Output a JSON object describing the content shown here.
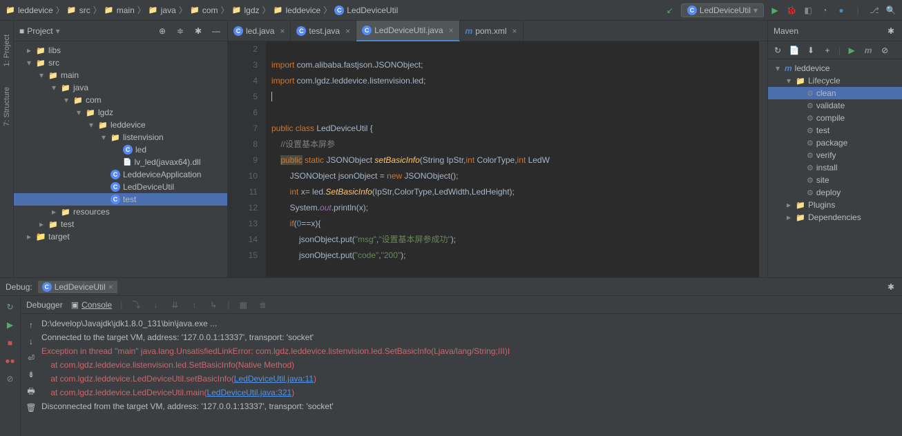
{
  "breadcrumb": [
    "leddevice",
    "src",
    "main",
    "java",
    "com",
    "lgdz",
    "leddevice",
    "LedDeviceUtil"
  ],
  "runConfig": "LedDeviceUtil",
  "projectPanel": {
    "title": "Project",
    "tree": [
      {
        "depth": 0,
        "arrow": "right",
        "icon": "folder",
        "label": "libs"
      },
      {
        "depth": 0,
        "arrow": "down",
        "icon": "folder",
        "label": "src"
      },
      {
        "depth": 1,
        "arrow": "down",
        "icon": "folder",
        "label": "main"
      },
      {
        "depth": 2,
        "arrow": "down",
        "icon": "folder",
        "label": "java"
      },
      {
        "depth": 3,
        "arrow": "down",
        "icon": "package",
        "label": "com"
      },
      {
        "depth": 4,
        "arrow": "down",
        "icon": "package",
        "label": "lgdz"
      },
      {
        "depth": 5,
        "arrow": "down",
        "icon": "package",
        "label": "leddevice"
      },
      {
        "depth": 6,
        "arrow": "down",
        "icon": "package",
        "label": "listenvision"
      },
      {
        "depth": 7,
        "arrow": "",
        "icon": "class",
        "label": "led"
      },
      {
        "depth": 7,
        "arrow": "",
        "icon": "dll",
        "label": "lv_led(javax64).dll"
      },
      {
        "depth": 6,
        "arrow": "",
        "icon": "class",
        "label": "LeddeviceApplication"
      },
      {
        "depth": 6,
        "arrow": "",
        "icon": "class",
        "label": "LedDeviceUtil"
      },
      {
        "depth": 6,
        "arrow": "",
        "icon": "class-run",
        "label": "test",
        "selected": true
      },
      {
        "depth": 2,
        "arrow": "right",
        "icon": "folder",
        "label": "resources"
      },
      {
        "depth": 1,
        "arrow": "right",
        "icon": "folder",
        "label": "test"
      },
      {
        "depth": 0,
        "arrow": "right",
        "icon": "folder-orange",
        "label": "target"
      }
    ]
  },
  "tabs": [
    {
      "icon": "class",
      "label": "led.java"
    },
    {
      "icon": "class",
      "label": "test.java"
    },
    {
      "icon": "class",
      "label": "LedDeviceUtil.java",
      "active": true
    },
    {
      "icon": "maven",
      "label": "pom.xml"
    }
  ],
  "code": {
    "startLine": 2,
    "lines": [
      {
        "gutter": "",
        "html": ""
      },
      {
        "gutter": "",
        "html": "<span class='kw'>import</span> com.alibaba.fastjson.JSONObject;"
      },
      {
        "gutter": "",
        "html": "<span class='kw'>import</span> com.lgdz.leddevice.listenvision.led;"
      },
      {
        "gutter": "",
        "html": "<span class='caret'></span>"
      },
      {
        "gutter": "",
        "html": ""
      },
      {
        "gutter": "run",
        "html": "<span class='kw'>public class</span> LedDeviceUtil {"
      },
      {
        "gutter": "",
        "html": "    <span class='cmt'>//设置基本屏参</span>"
      },
      {
        "gutter": "at",
        "html": "    <span class='highlight'><span class='kw'>public</span></span> <span class='kw'>static</span> JSONObject <span class='fn'>setBasicInfo</span>(String IpStr,<span class='kw'>int</span> ColorType,<span class='kw'>int</span> LedW"
      },
      {
        "gutter": "",
        "html": "        JSONObject jsonObject = <span class='kw'>new</span> JSONObject();"
      },
      {
        "gutter": "",
        "html": "        <span class='kw'>int</span> x= led.<span class='fn' style='font-style:italic'>SetBasicInfo</span>(IpStr,ColorType,LedWidth,LedHeight);"
      },
      {
        "gutter": "",
        "html": "        System.<span style='color:#9876aa;font-style:italic'>out</span>.println(x);"
      },
      {
        "gutter": "",
        "html": "        <span class='kw'>if</span>(<span class='num'>0</span>==x){"
      },
      {
        "gutter": "",
        "html": "            jsonObject.put(<span class='str'>\"msg\"</span>,<span class='str'>\"设置基本屏参成功\"</span>);"
      },
      {
        "gutter": "",
        "html": "            jsonObject.put(<span class='str'>\"code\"</span>,<span class='str'>\"200\"</span>);"
      }
    ]
  },
  "maven": {
    "title": "Maven",
    "items": [
      {
        "depth": 0,
        "arrow": "down",
        "icon": "maven",
        "label": "leddevice"
      },
      {
        "depth": 1,
        "arrow": "down",
        "icon": "folder",
        "label": "Lifecycle"
      },
      {
        "depth": 2,
        "icon": "gear",
        "label": "clean",
        "selected": true
      },
      {
        "depth": 2,
        "icon": "gear",
        "label": "validate"
      },
      {
        "depth": 2,
        "icon": "gear",
        "label": "compile"
      },
      {
        "depth": 2,
        "icon": "gear",
        "label": "test"
      },
      {
        "depth": 2,
        "icon": "gear",
        "label": "package"
      },
      {
        "depth": 2,
        "icon": "gear",
        "label": "verify"
      },
      {
        "depth": 2,
        "icon": "gear",
        "label": "install"
      },
      {
        "depth": 2,
        "icon": "gear",
        "label": "site"
      },
      {
        "depth": 2,
        "icon": "gear",
        "label": "deploy"
      },
      {
        "depth": 1,
        "arrow": "right",
        "icon": "folder",
        "label": "Plugins"
      },
      {
        "depth": 1,
        "arrow": "right",
        "icon": "folder",
        "label": "Dependencies"
      }
    ]
  },
  "debug": {
    "label": "Debug:",
    "configName": "LedDeviceUtil",
    "debuggerTab": "Debugger",
    "consoleTab": "Console",
    "console": [
      {
        "cls": "",
        "text": "D:\\develop\\Javajdk\\jdk1.8.0_131\\bin\\java.exe ..."
      },
      {
        "cls": "",
        "text": "Connected to the target VM, address: '127.0.0.1:13337', transport: 'socket'"
      },
      {
        "cls": "err",
        "text": "Exception in thread \"main\" java.lang.UnsatisfiedLinkError: com.lgdz.leddevice.listenvision.led.SetBasicInfo(Ljava/lang/String;III)I"
      },
      {
        "cls": "err",
        "text": "    at com.lgdz.leddevice.listenvision.led.SetBasicInfo(Native Method)"
      },
      {
        "cls": "err",
        "html": "    at com.lgdz.leddevice.LedDeviceUtil.setBasicInfo(<span class='link'>LedDeviceUtil.java:11</span>)"
      },
      {
        "cls": "err",
        "html": "    at com.lgdz.leddevice.LedDeviceUtil.main(<span class='link'>LedDeviceUtil.java:321</span>)"
      },
      {
        "cls": "",
        "text": "Disconnected from the target VM, address: '127.0.0.1:13337', transport: 'socket'"
      }
    ]
  }
}
